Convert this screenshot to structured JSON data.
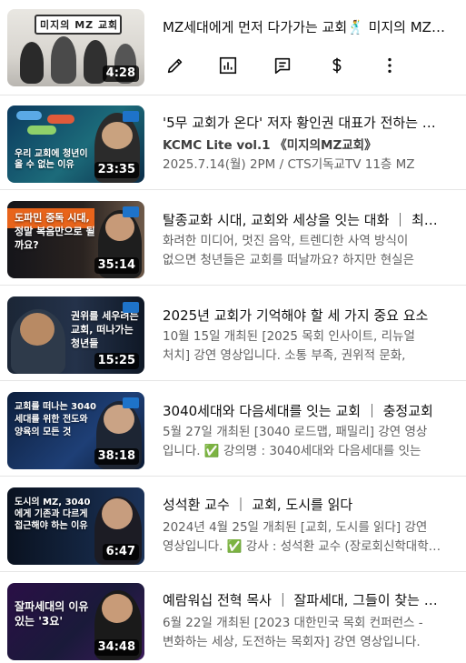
{
  "videos": [
    {
      "title": "MZ세대에게 먼저 다가가는 교회🕺 미지의 MZ교회",
      "duration": "4:28",
      "thumb_text": "미지의 MZ 교회"
    },
    {
      "title": "'5무 교회가 온다' 저자 황인권 대표가 전하는 청년이 올 수 없는 교회",
      "channel_line": "KCMC Lite vol.1 《미지의MZ교회》",
      "date_line": "2025.7.14(월) 2PM / CTS기독교TV 11층 MZ",
      "duration": "23:35",
      "thumb_text": "우리 교회에 청년이 올 수 없는 이유"
    },
    {
      "title": "탈종교화 시대, 교회와 세상을 잇는 대화 ｜ 최성렬 목사",
      "line1": "화려한 미디어, 멋진 음악, 트렌디한 사역 방식이",
      "line2": "없으면 청년들은 교회를 떠날까요? 하지만 현실은",
      "duration": "35:14",
      "thumb_text": "도파민 중독 시대, 정말 복음만으로 될까요?"
    },
    {
      "title": "2025년 교회가 기억해야 할 세 가지 중요 요소",
      "line1": "10월 15일 개최된 [2025 목회 인사이트, 리뉴얼",
      "line2": "처치] 강연 영상입니다. 소통 부족, 권위적 문화,",
      "duration": "15:25",
      "thumb_text": "권위를 세우려는 교회, 떠나가는 청년들"
    },
    {
      "title": "3040세대와 다음세대를 잇는 교회 ｜ 충정교회",
      "line1": "5월 27일 개최된 [3040 로드맵, 패밀리] 강연 영상",
      "line2": "입니다. ✅ 강의명 : 3040세대와 다음세대를 잇는",
      "duration": "38:18",
      "thumb_text": "교회를 떠나는 3040세대를 위한 전도와 양육의 모든 것"
    },
    {
      "title": "성석환 교수 ｜ 교회, 도시를 읽다",
      "line1": "2024년 4월 25일 개최된 [교회, 도시를 읽다] 강연",
      "line2": "영상입니다. ✅ 강사 : 성석환 교수 (장로회신학대학교)",
      "duration": "6:47",
      "thumb_text": "도시의 MZ, 3040에게 기존과 다르게 접근해야 하는 이유"
    },
    {
      "title": "예람워십 전혁 목사 ｜ 잘파세대, 그들이 찾는 교회",
      "line1": "6월 22일 개최된 [2023 대한민국 목회 컨퍼런스 -",
      "line2": "변화하는 세상, 도전하는 목회자] 강연 영상입니다.",
      "duration": "34:48",
      "thumb_text": "잘파세대의 이유 있는 '3요'"
    }
  ],
  "actions": [
    "edit",
    "analytics",
    "comments",
    "earn"
  ],
  "colors": {
    "checkmark": "#2ea44f",
    "badge": "#1e73c9",
    "highlight_yellow": "#ffd400"
  }
}
